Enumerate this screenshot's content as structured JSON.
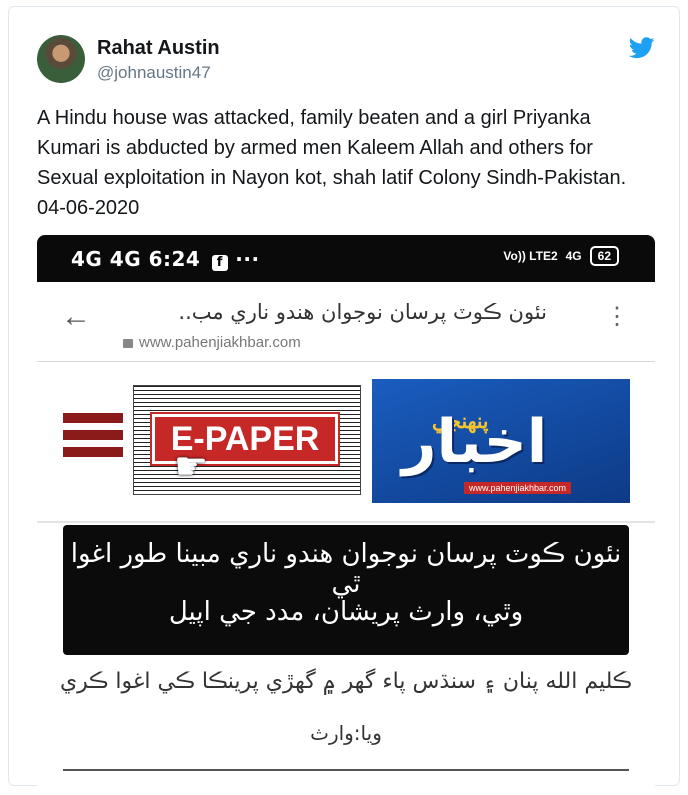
{
  "tweet": {
    "author_name": "Rahat Austin",
    "author_handle": "@johnaustin47",
    "text": "A Hindu house was attacked, family beaten and a girl Priyanka Kumari is abducted by armed men Kaleem Allah and others for Sexual exploitation in Nayon kot, shah latif Colony Sindh-Pakistan. 04-06-2020",
    "brand_icon": "twitter-bird-icon",
    "brand_color": "#1da1f2"
  },
  "phone": {
    "status_left": "4G 4G 6:24",
    "status_extra": "···",
    "status_right": "Vo)) LTE2",
    "network": "4G",
    "battery": "62"
  },
  "browser": {
    "page_title": "نئون ڪوٽ پرسان نوجوان هندو ناري مب..",
    "host": "www.pahenjiakhbar.com",
    "back_icon": "arrow-left-icon",
    "menu_icon": "kebab-menu-icon"
  },
  "banner": {
    "epaper_label": "E-PAPER",
    "logo_name": "اخبار",
    "logo_sub": "پنهنجي",
    "logo_url": "www.pahenjiakhbar.com",
    "logo_color": "#1a5dbf",
    "menu_color": "#8b1a1a"
  },
  "article": {
    "headline_line1": "نئون ڪوٽ پرسان نوجوان هندو ناري مبينا طور اغوا ٿي",
    "headline_line2": "وٿي، وارث پريشان، مدد جي اپيل",
    "subline1": "ڪليم الله پنان ۽ سنڌس پاء گهر ۾ گهڙي پرينڪا ڪي اغوا ڪري",
    "subline2": "ويا:وارث"
  }
}
